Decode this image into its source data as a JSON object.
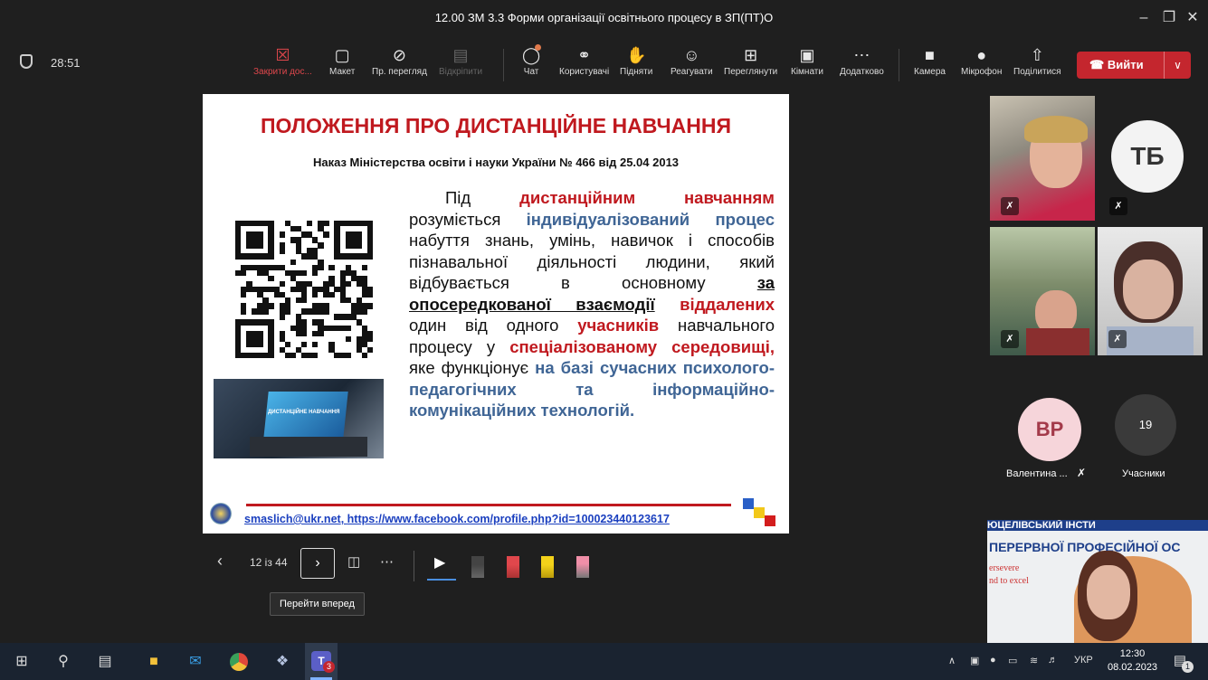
{
  "window": {
    "title": "12.00 ЗМ 3.3 Форми організації освітнього процесу в ЗП(ПТ)О"
  },
  "meeting": {
    "timer": "28:51"
  },
  "toolbar": {
    "items": [
      {
        "label": "Закрити дос...",
        "icon": "close-share-icon"
      },
      {
        "label": "Макет",
        "icon": "layout-icon"
      },
      {
        "label": "Пр. перегляд",
        "icon": "eye-off-icon"
      },
      {
        "label": "Відкріпити",
        "icon": "unpin-icon"
      },
      {
        "label": "Чат",
        "icon": "chat-icon"
      },
      {
        "label": "Користувачі",
        "icon": "people-icon"
      },
      {
        "label": "Підняти",
        "icon": "raise-hand-icon"
      },
      {
        "label": "Реагувати",
        "icon": "smile-icon"
      },
      {
        "label": "Переглянути",
        "icon": "view-icon"
      },
      {
        "label": "Кімнати",
        "icon": "rooms-icon"
      },
      {
        "label": "Додатково",
        "icon": "more-icon"
      },
      {
        "label": "Камера",
        "icon": "camera-icon"
      },
      {
        "label": "Мікрофон",
        "icon": "mic-icon"
      },
      {
        "label": "Поділитися",
        "icon": "share-icon"
      }
    ],
    "leave_label": "Вийти"
  },
  "slide": {
    "title": "ПОЛОЖЕННЯ ПРО ДИСТАНЦІЙНЕ НАВЧАННЯ",
    "subtitle": "Наказ Міністерства освіти і науки України № 466 від 25.04 2013",
    "photo_caption": "ДИСТАНЦІЙНЕ НАВЧАННЯ",
    "text": {
      "t1": "Під ",
      "t2": "дистанційним навчанням",
      "t3": " розуміється ",
      "t4": "індивідуалізований процес",
      "t5": " набуття знань, умінь, навичок і способів пізнавальної діяльності людини, який відбувається в основному ",
      "t6": "за опосередкованої взаємодії",
      "t7": " ",
      "t8": "віддалених",
      "t9": " один від одного ",
      "t10": "учасників",
      "t11": " навчального процесу у ",
      "t12": "спеціалізованому середовищі,",
      "t13": " яке функціонує ",
      "t14": "на базі сучасних психолого-педагогічних та інформаційно-комунікаційних технологій",
      "t15": "."
    },
    "footer_email": "smaslich@ukr.net",
    "footer_sep": ", ",
    "footer_url": "https://www.facebook.com/profile.php?id=100023440123617"
  },
  "slide_controls": {
    "page": "12 із 44",
    "tooltip": "Перейти вперед"
  },
  "participants": {
    "avatar_tb": "ТБ",
    "avatar_vr": "ВР",
    "vr_name": "Валентина ...",
    "count": "19",
    "count_label": "Учасники",
    "banner_line1": "ПЕРЕРВНОЇ ПРОФЕСІЙНОЇ ОС",
    "banner_line0": "ЮЦЕЛІВСЬКИЙ ІНСТИ",
    "banner_side1": "ersevere",
    "banner_side2": "nd to excel"
  },
  "taskbar": {
    "lang": "УКР",
    "time": "12:30",
    "date": "08.02.2023",
    "teams_badge": "3",
    "notif_badge": "1"
  },
  "colors": {
    "slide_red": "#c0191f",
    "slide_blue": "#3f6595",
    "leave_red": "#c4262e",
    "avatar_tb_bg": "#f3f3f3",
    "avatar_vr_bg": "#f6d5da"
  }
}
